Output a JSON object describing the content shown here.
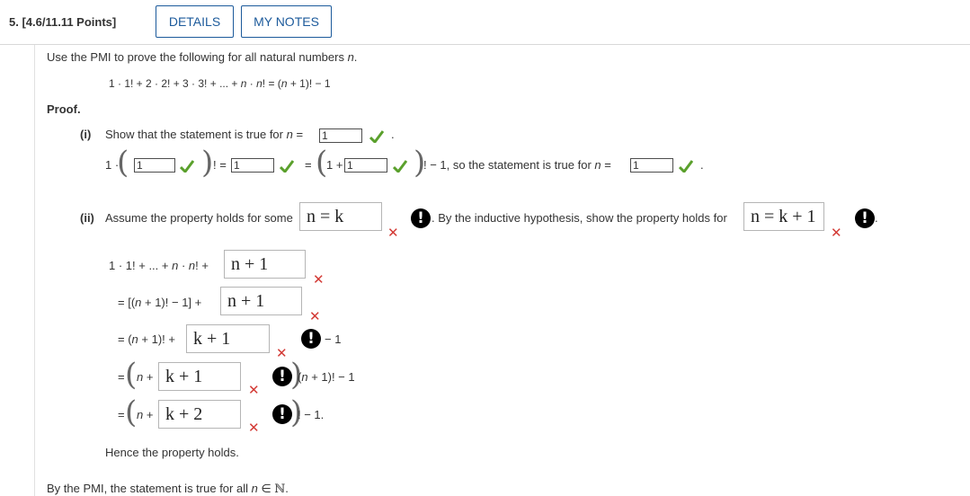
{
  "header": {
    "question_title": "5.  [4.6/11.11 Points]",
    "details_label": "DETAILS",
    "notes_label": "MY NOTES"
  },
  "prompt": {
    "intro_start": "Use the PMI to prove the following for all natural numbers ",
    "intro_var": "n",
    "intro_end": ".",
    "formula_a": "1 · 1! + 2 · 2! + 3 · 3! + ... + ",
    "formula_b": " · ",
    "formula_c": "! = (",
    "formula_d": " + 1)! − 1",
    "n": "n"
  },
  "proof_label": "Proof.",
  "part1": {
    "label": "(i)",
    "text": "Show that the statement is true for ",
    "eq": " = ",
    "answer_n": "1",
    "dot": ".",
    "row2_lead": "1 ·",
    "row2_box1": "1",
    "row2_fact_eq": "! =",
    "row2_box2": "1",
    "row2_eq": "=",
    "row2_one_plus": "1 +",
    "row2_box3": "1",
    "row2_tail": "! − 1, so the statement is true for ",
    "row2_box4": "1",
    "row2_end": "."
  },
  "part2": {
    "label": "(ii)",
    "assume_text": "Assume the property holds for some",
    "assume_answer": "n = k",
    "mid_text": ". By the inductive hypothesis, show the property holds for",
    "show_answer": "n = k + 1",
    "period": ".",
    "line1_text_a": "1 · 1! + ... + ",
    "line1_text_b": " · ",
    "line1_text_c": "! +",
    "line1_answer": "n + 1",
    "line2_text": "= [(",
    "line2_text_b": " + 1)! − 1] +",
    "line2_answer": "n + 1",
    "line3_text_a": "= (",
    "line3_text_b": " + 1)! +",
    "line3_answer": "k + 1",
    "line3_tail": "− 1",
    "line4_eq": "=",
    "line4_plus": " +",
    "line4_answer": "k + 1",
    "line4_tail_a": "(",
    "line4_tail_b": " + 1)! − 1",
    "line5_eq": "=",
    "line5_plus": " +",
    "line5_answer": "k + 2",
    "line5_tail": "! − 1.",
    "hence": "Hence the property holds."
  },
  "conclusion": {
    "text": "By the PMI, the statement is true for all ",
    "in": " ∈ ",
    "set": "ℕ",
    "end": "."
  },
  "icons": {
    "check": "check-icon",
    "wrong": "x-icon",
    "alert": "exclamation-icon"
  },
  "colors": {
    "accent": "#1c5a9b",
    "correct": "#5aa02c",
    "incorrect": "#d33a35"
  }
}
